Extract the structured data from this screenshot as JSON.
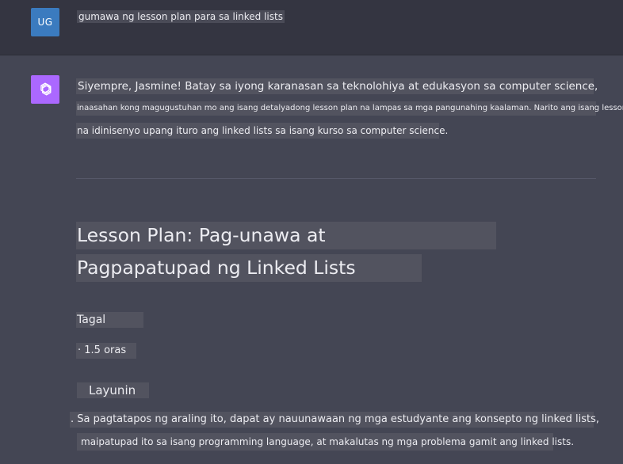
{
  "user_message": {
    "avatar_initials": "UG",
    "text": "gumawa ng lesson plan para sa linked lists"
  },
  "assistant_message": {
    "avatar_icon": "openai-logo-icon",
    "intro_line1": "Siyempre, Jasmine! Batay sa iyong karanasan sa teknolohiya at edukasyon sa computer science,",
    "intro_line2": "inaasahan kong magugustuhan mo ang isang detalyadong lesson plan na lampas sa mga pangunahing kaalaman. Narito ang isang lesson plan",
    "intro_line3": "na idinisenyo upang ituro ang linked lists sa isang kurso sa computer science.",
    "title_line1": "Lesson Plan: Pag-unawa at",
    "title_line2": "Pagpapatupad ng Linked Lists",
    "duration_heading": "Tagal",
    "duration_value": "· 1.5 oras",
    "objectives_heading": "Layunin",
    "objective_line1": ". Sa pagtatapos ng araling ito, dapat ay nauunawaan ng mga estudyante ang konsepto ng linked lists,",
    "objective_line2": "maipatupad ito sa isang programming language, at makalutas ng mga problema gamit ang linked lists."
  },
  "colors": {
    "user_row_bg": "#343541",
    "assistant_row_bg": "#444654",
    "user_avatar": "#3b7bbf",
    "assistant_avatar": "#ab68ff"
  }
}
